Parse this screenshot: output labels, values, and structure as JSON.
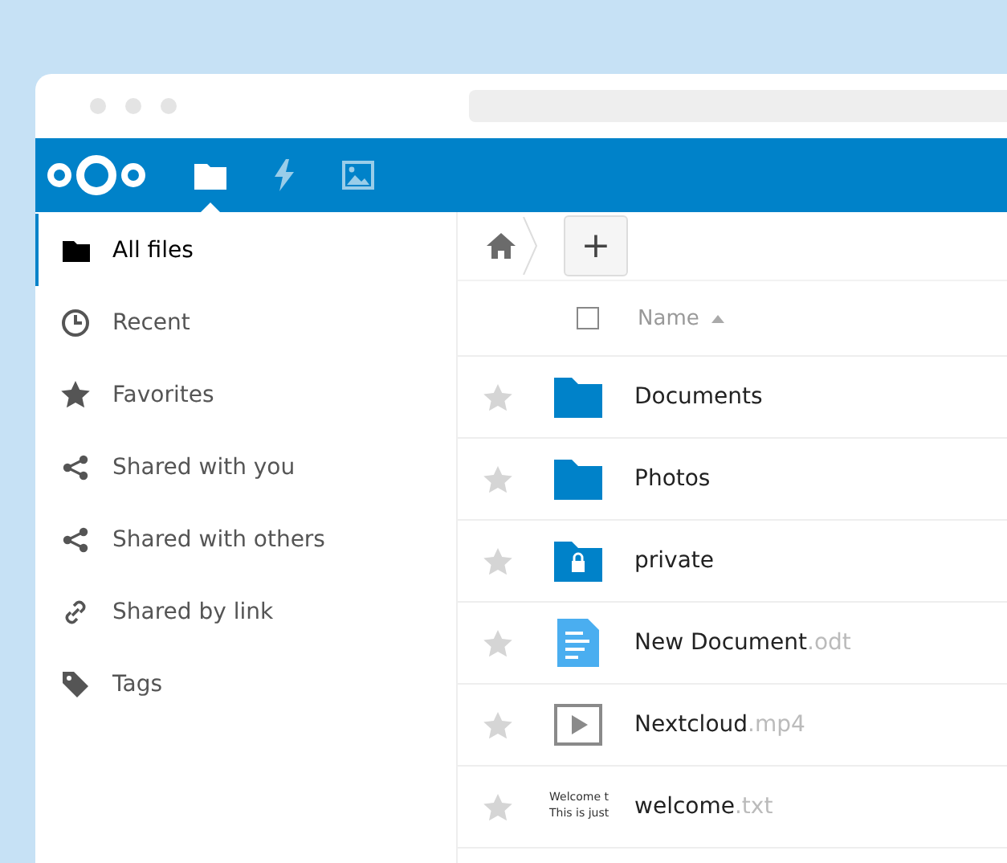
{
  "header": {
    "apps": [
      {
        "kind": "files",
        "selected": true
      },
      {
        "kind": "activity",
        "selected": false
      },
      {
        "kind": "gallery",
        "selected": false
      }
    ]
  },
  "sidebar": {
    "items": [
      {
        "kind": "folder",
        "label": "All files",
        "selected": true
      },
      {
        "kind": "clock",
        "label": "Recent",
        "selected": false
      },
      {
        "kind": "star",
        "label": "Favorites",
        "selected": false
      },
      {
        "kind": "share",
        "label": "Shared with you",
        "selected": false
      },
      {
        "kind": "share",
        "label": "Shared with others",
        "selected": false
      },
      {
        "kind": "link",
        "label": "Shared by link",
        "selected": false
      },
      {
        "kind": "tag",
        "label": "Tags",
        "selected": false
      }
    ]
  },
  "toolbar": {
    "new_button": "+"
  },
  "table": {
    "columns": [
      {
        "label": "Name",
        "sorted": true
      }
    ],
    "select_all": {
      "checked": false
    },
    "rows": [
      {
        "kind": "folder",
        "name": "Documents",
        "extension": "",
        "favorite": false
      },
      {
        "kind": "folder",
        "name": "Photos",
        "extension": "",
        "favorite": false
      },
      {
        "kind": "locked-folder",
        "name": "private",
        "extension": "",
        "favorite": false
      },
      {
        "kind": "document",
        "name": "New Document",
        "extension": ".odt",
        "favorite": false
      },
      {
        "kind": "video",
        "name": "Nextcloud",
        "extension": ".mp4",
        "favorite": false
      },
      {
        "kind": "text",
        "name": "welcome",
        "extension": ".txt",
        "favorite": false,
        "preview_lines": [
          "Welcome t",
          "This is just"
        ]
      }
    ]
  }
}
